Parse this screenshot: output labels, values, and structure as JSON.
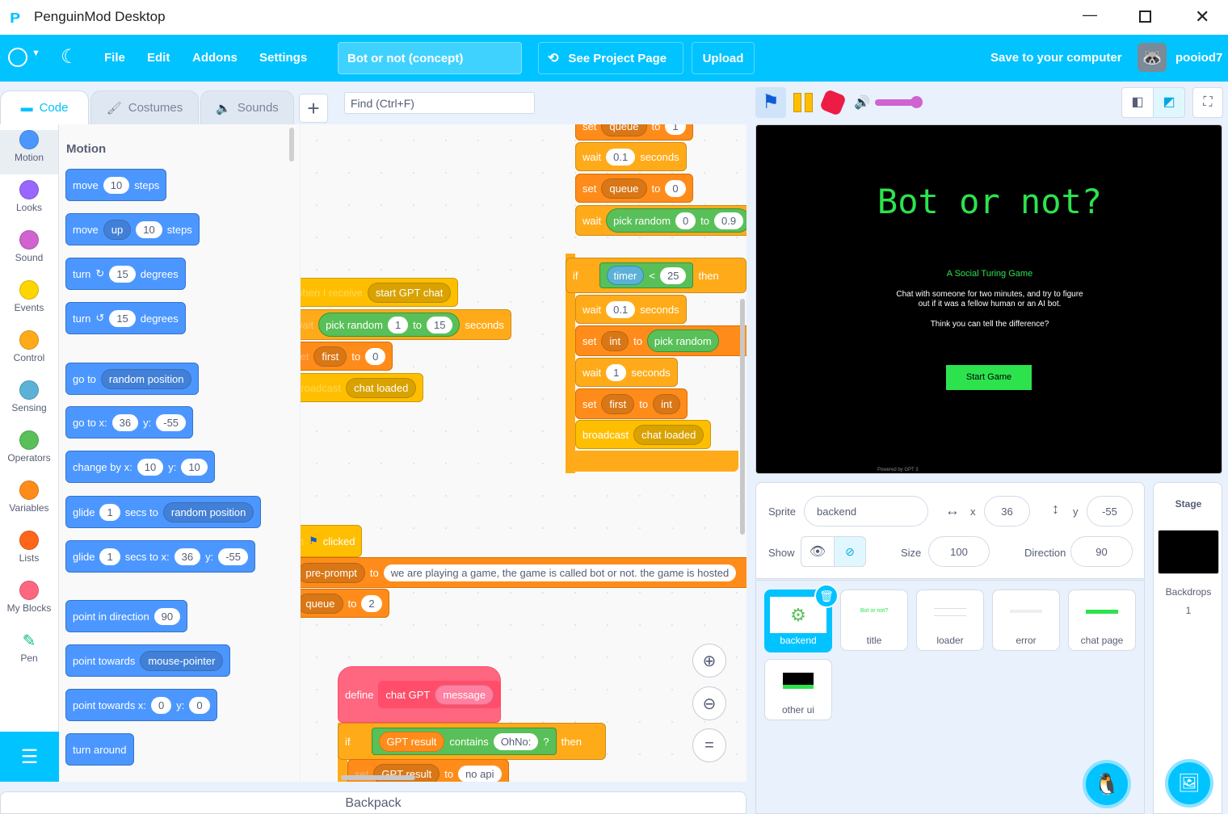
{
  "window": {
    "title": "PenguinMod Desktop"
  },
  "menu": {
    "file": "File",
    "edit": "Edit",
    "addons": "Addons",
    "settings": "Settings",
    "project_title": "Bot or not (concept)",
    "see_project": "See Project Page",
    "upload": "Upload",
    "save": "Save to your computer",
    "username": "pooiod7"
  },
  "tabs": {
    "code": "Code",
    "costumes": "Costumes",
    "sounds": "Sounds",
    "find_placeholder": "Find (Ctrl+F)"
  },
  "categories": [
    "Motion",
    "Looks",
    "Sound",
    "Events",
    "Control",
    "Sensing",
    "Operators",
    "Variables",
    "Lists",
    "My Blocks",
    "Pen"
  ],
  "category_colors": [
    "#4c97ff",
    "#9966ff",
    "#cf63cf",
    "#ffd500",
    "#ffab19",
    "#5cb1d6",
    "#59c059",
    "#ff8c1a",
    "#ff661a",
    "#ff6680",
    "#0fbd8c"
  ],
  "palette": {
    "heading": "Motion",
    "move": "move",
    "n10": "10",
    "steps": "steps",
    "up": "up",
    "turn": "turn",
    "n15": "15",
    "degrees": "degrees",
    "goto": "go to",
    "random_position": "random position",
    "goto_xy": "go to x:",
    "x36": "36",
    "y_lbl": "y:",
    "y55": "-55",
    "change_by_x": "change by x:",
    "glide": "glide",
    "n1": "1",
    "secs_to": "secs to",
    "secs_to_x": "secs to x:",
    "point_dir": "point in direction",
    "n90": "90",
    "point_towards": "point towards",
    "mouse_pointer": "mouse-pointer",
    "point_towards_x": "point towards x:",
    "n0": "0",
    "turn_around": "turn around"
  },
  "script": {
    "set": "set",
    "queue": "queue",
    "to": "to",
    "n1": "1",
    "wait": "wait",
    "n01": "0.1",
    "seconds": "seconds",
    "n0": "0",
    "pick_random": "pick random",
    "n099": "0.9",
    "if": "if",
    "timer": "timer",
    "lt": "<",
    "n25": "25",
    "then": "then",
    "int": "int",
    "first": "first",
    "broadcast": "broadcast",
    "chat_loaded": "chat loaded",
    "when_receive": "when I receive",
    "start_gpt": "start GPT chat",
    "n15": "15",
    "when": "when",
    "clicked": "clicked",
    "pre_prompt": "pre-prompt",
    "prompt_text": "we are playing a game, the game is called bot or not. the game is hosted",
    "n2": "2",
    "define": "define",
    "chat_gpt": "chat GPT",
    "message": "message",
    "gpt_result": "GPT result",
    "contains": "contains",
    "ohno": "OhNo:",
    "q": "?",
    "no_api": "no api"
  },
  "stage": {
    "title": "Bot or not?",
    "subtitle": "A Social Turing Game",
    "desc1": "Chat with someone for two minutes, and try to figure",
    "desc2": "out if it was a fellow human or an AI bot.",
    "desc3": "Think you can tell the difference?",
    "button": "Start Game",
    "footer": "Powered by GPT 3"
  },
  "sprite_info": {
    "sprite_label": "Sprite",
    "sprite_name": "backend",
    "x_label": "x",
    "x": "36",
    "y_label": "y",
    "y": "-55",
    "show_label": "Show",
    "size_label": "Size",
    "size": "100",
    "direction_label": "Direction",
    "direction": "90"
  },
  "sprites": [
    {
      "name": "backend"
    },
    {
      "name": "title"
    },
    {
      "name": "loader"
    },
    {
      "name": "error"
    },
    {
      "name": "chat page"
    },
    {
      "name": "other ui"
    }
  ],
  "stage_panel": {
    "label": "Stage",
    "backdrops_label": "Backdrops",
    "backdrops": "1"
  },
  "backpack": "Backpack",
  "colors": {
    "accent": "#00c3ff",
    "stage_green": "#2ce34e"
  }
}
